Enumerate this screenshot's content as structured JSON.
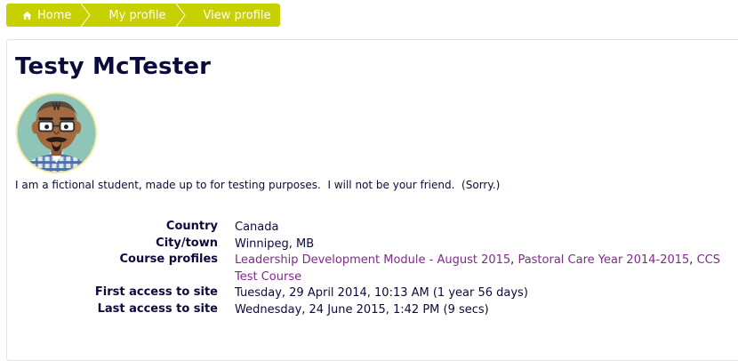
{
  "breadcrumb": {
    "home": "Home",
    "my_profile": "My profile",
    "view_profile": "View profile"
  },
  "profile": {
    "name": "Testy McTester",
    "description": "I am a fictional student, made up to for testing purposes.  I will not be your friend.  (Sorry.)"
  },
  "details": {
    "country_label": "Country",
    "country_value": "Canada",
    "city_label": "City/town",
    "city_value": "Winnipeg, MB",
    "courses_label": "Course profiles",
    "courses": [
      "Leadership Development Module - August 2015",
      "Pastoral Care Year 2014-2015",
      "CCS Test Course"
    ],
    "course_separator": ", ",
    "first_access_label": "First access to site",
    "first_access_value": "Tuesday, 29 April 2014, 10:13 AM  (1 year 56 days)",
    "last_access_label": "Last access to site",
    "last_access_value": "Wednesday, 24 June 2015, 1:42 PM  (9 secs)"
  },
  "colors": {
    "breadcrumb_bg": "#c7d000",
    "link": "#7f2a8a",
    "text": "#0b0b3b"
  },
  "icons": {
    "home": "home-icon",
    "avatar": "user-avatar"
  }
}
